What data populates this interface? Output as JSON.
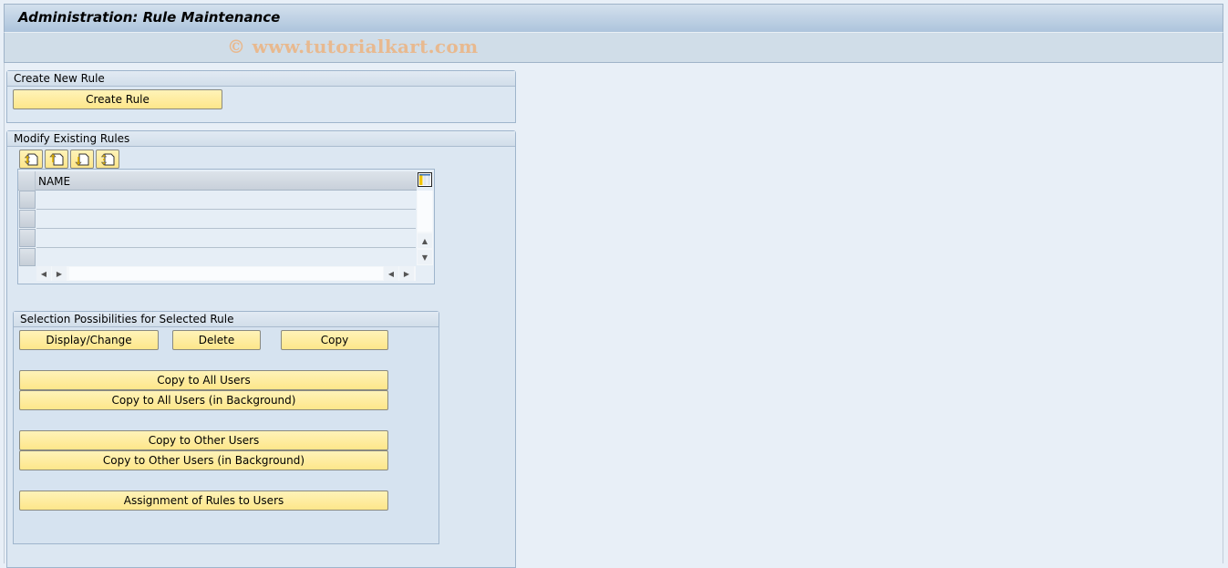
{
  "window": {
    "title": "Administration: Rule Maintenance",
    "watermark": "© www.tutorialkart.com"
  },
  "create_group": {
    "title": "Create New Rule",
    "create_rule_label": "Create Rule"
  },
  "modify_group": {
    "title": "Modify Existing Rules",
    "toolbar_icons": [
      "insert-row-icon",
      "append-row-icon",
      "insert-row-below-icon",
      "duplicate-row-icon"
    ],
    "table": {
      "columns": [
        "NAME"
      ],
      "rows": [
        "",
        "",
        "",
        ""
      ]
    }
  },
  "selection_group": {
    "title": "Selection Possibilities for Selected Rule",
    "display_change_label": "Display/Change",
    "delete_label": "Delete",
    "copy_label": "Copy",
    "copy_all_users_label": "Copy to All Users",
    "copy_all_users_bg_label": "Copy to All Users (in Background)",
    "copy_other_users_label": "Copy to Other Users",
    "copy_other_users_bg_label": "Copy to Other Users (in Background)",
    "assignment_label": "Assignment of Rules to Users"
  }
}
